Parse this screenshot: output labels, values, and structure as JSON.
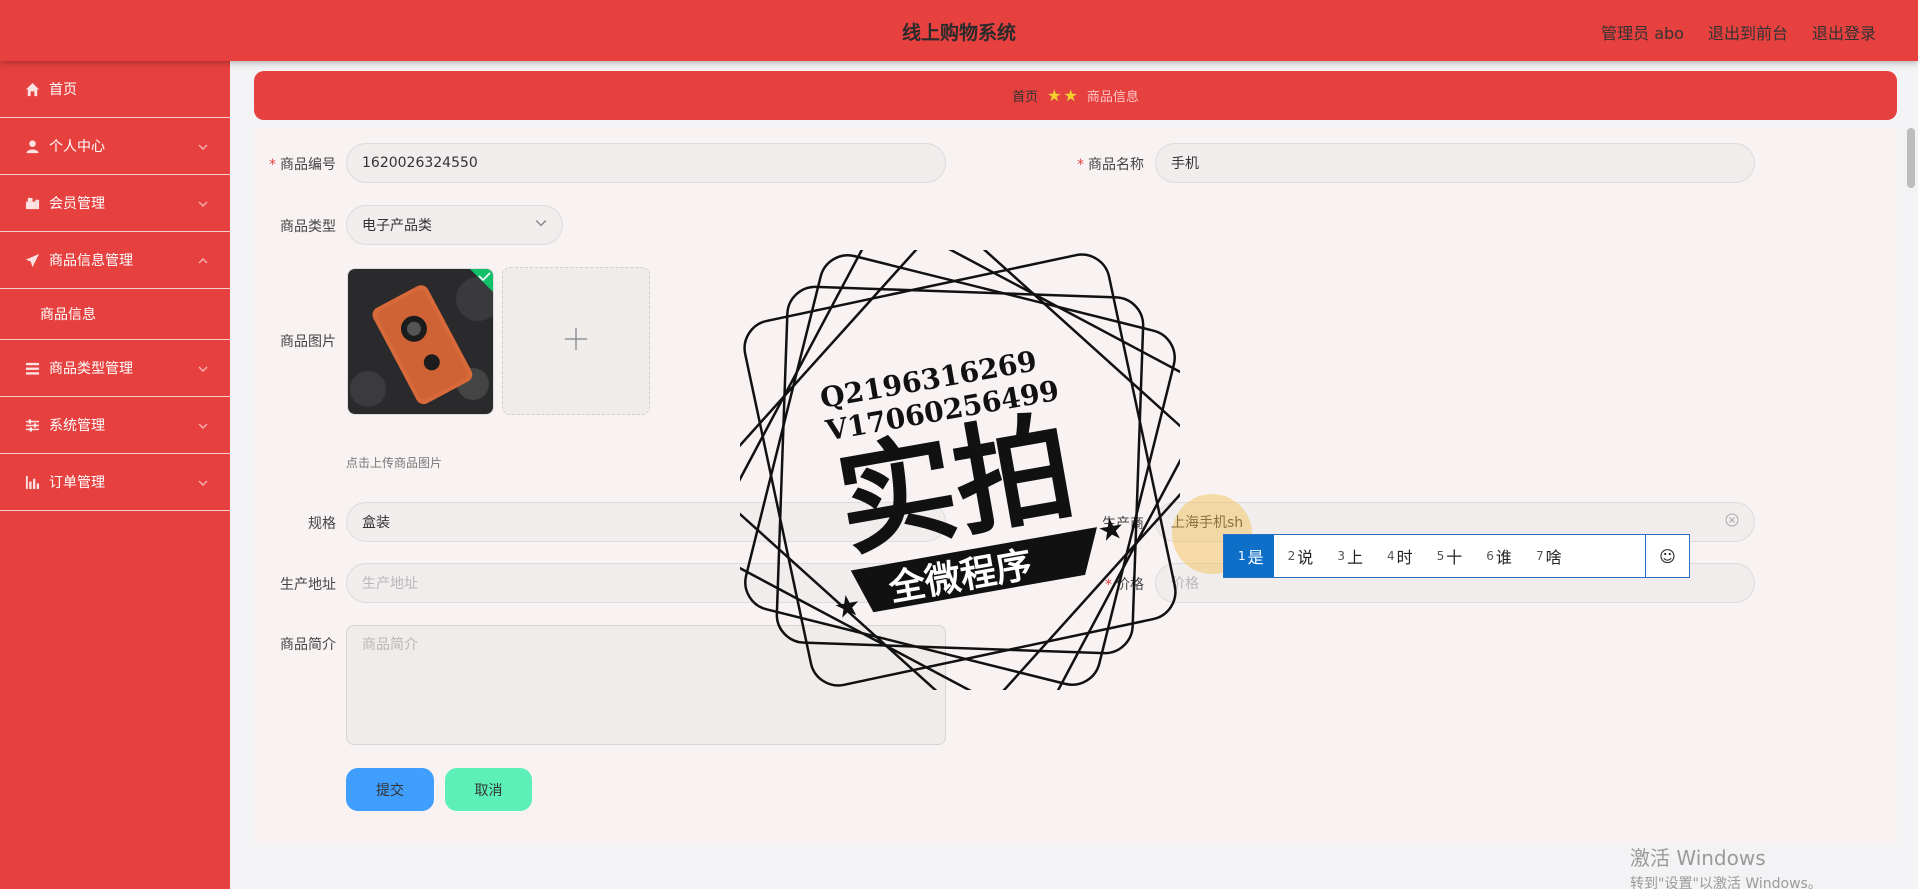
{
  "header": {
    "title": "线上购物系统",
    "admin": "管理员 abo",
    "front_link": "退出到前台",
    "logout_link": "退出登录"
  },
  "sidebar": {
    "items": [
      {
        "label": "首页",
        "icon": "home-icon"
      },
      {
        "label": "个人中心",
        "icon": "user-icon"
      },
      {
        "label": "会员管理",
        "icon": "member-icon"
      },
      {
        "label": "商品信息管理",
        "icon": "send-icon"
      },
      {
        "label": "商品信息",
        "icon": ""
      },
      {
        "label": "商品类型管理",
        "icon": "list-icon"
      },
      {
        "label": "系统管理",
        "icon": "settings-icon"
      },
      {
        "label": "订单管理",
        "icon": "chart-icon"
      }
    ]
  },
  "breadcrumb": {
    "home": "首页",
    "current": "商品信息"
  },
  "form": {
    "product_no_label": "商品编号",
    "product_no_value": "1620026324550",
    "product_name_label": "商品名称",
    "product_name_value": "手机",
    "category_label": "商品类型",
    "category_value": "电子产品类",
    "image_label": "商品图片",
    "upload_tip": "点击上传商品图片",
    "spec_label": "规格",
    "spec_value": "盒装",
    "maker_label": "生产商",
    "maker_value": "上海手机sh",
    "address_label": "生产地址",
    "address_placeholder": "生产地址",
    "price_label": "价格",
    "price_placeholder": "价格",
    "intro_label": "商品简介",
    "intro_placeholder": "商品简介",
    "submit": "提交",
    "cancel": "取消"
  },
  "stamp": {
    "line1": "Q2196316269",
    "line2": "V17060256499",
    "big": "实拍",
    "banner": "全微程序"
  },
  "ime": {
    "candidates": [
      {
        "n": "1",
        "t": "是"
      },
      {
        "n": "2",
        "t": "说"
      },
      {
        "n": "3",
        "t": "上"
      },
      {
        "n": "4",
        "t": "时"
      },
      {
        "n": "5",
        "t": "十"
      },
      {
        "n": "6",
        "t": "谁"
      },
      {
        "n": "7",
        "t": "啥"
      }
    ],
    "emoji": "☺"
  },
  "activation": {
    "line1": "激活 Windows",
    "line2": "转到\"设置\"以激活 Windows。"
  },
  "colors": {
    "brand": "#e6403f",
    "submit": "#409eff",
    "cancel": "#5cf0b8"
  }
}
